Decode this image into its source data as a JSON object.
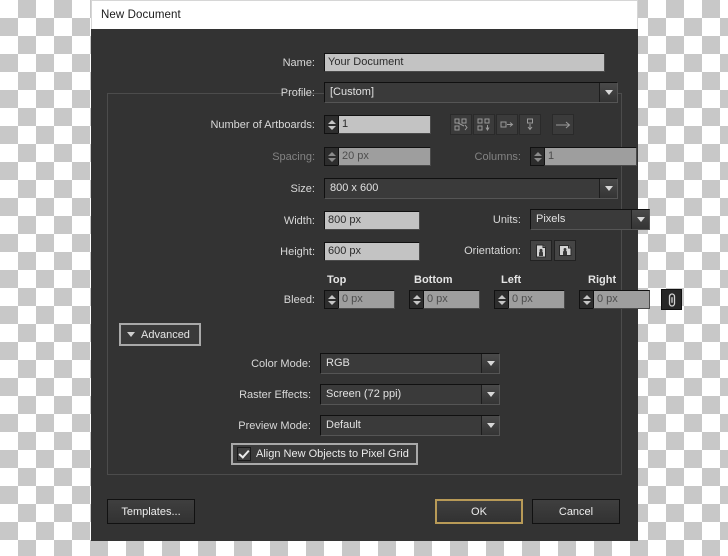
{
  "window": {
    "title": "New Document"
  },
  "form": {
    "name": {
      "label": "Name:",
      "value": "Your Document"
    },
    "profile": {
      "label": "Profile:",
      "value": "[Custom]"
    },
    "artboards": {
      "label": "Number of Artboards:",
      "value": "1",
      "arrange_icons": [
        "grid-by-row-icon",
        "grid-by-column-icon",
        "arrange-by-row-icon",
        "arrange-by-column-icon"
      ],
      "direction_icon": "left-to-right-icon"
    },
    "spacing": {
      "label": "Spacing:",
      "value": "20 px",
      "disabled": true
    },
    "columns": {
      "label": "Columns:",
      "value": "1",
      "disabled": true
    },
    "size": {
      "label": "Size:",
      "value": "800 x 600"
    },
    "width": {
      "label": "Width:",
      "value": "800 px"
    },
    "height": {
      "label": "Height:",
      "value": "600 px"
    },
    "units": {
      "label": "Units:",
      "value": "Pixels"
    },
    "orientation": {
      "label": "Orientation:",
      "portrait_icon": "portrait-page-icon",
      "landscape_icon": "landscape-page-icon"
    },
    "bleed": {
      "label": "Bleed:",
      "headers": [
        "Top",
        "Bottom",
        "Left",
        "Right"
      ],
      "values": [
        "0 px",
        "0 px",
        "0 px",
        "0 px"
      ],
      "link_icon": "chain-link-icon"
    }
  },
  "advanced": {
    "toggle_label": "Advanced",
    "color_mode": {
      "label": "Color Mode:",
      "value": "RGB"
    },
    "raster_effects": {
      "label": "Raster Effects:",
      "value": "Screen (72 ppi)"
    },
    "preview_mode": {
      "label": "Preview Mode:",
      "value": "Default"
    },
    "align_pixel_grid": {
      "label": "Align New Objects to Pixel Grid",
      "checked": true
    }
  },
  "footer": {
    "templates": "Templates...",
    "ok": "OK",
    "cancel": "Cancel"
  },
  "colors": {
    "dialog_bg": "#333333",
    "titlebar_bg": "#ffffff",
    "field_bg": "#c3c3c3",
    "field_disabled_bg": "#9e9e9e",
    "focus_border": "#b89a57",
    "text": "#d8d8d8"
  }
}
